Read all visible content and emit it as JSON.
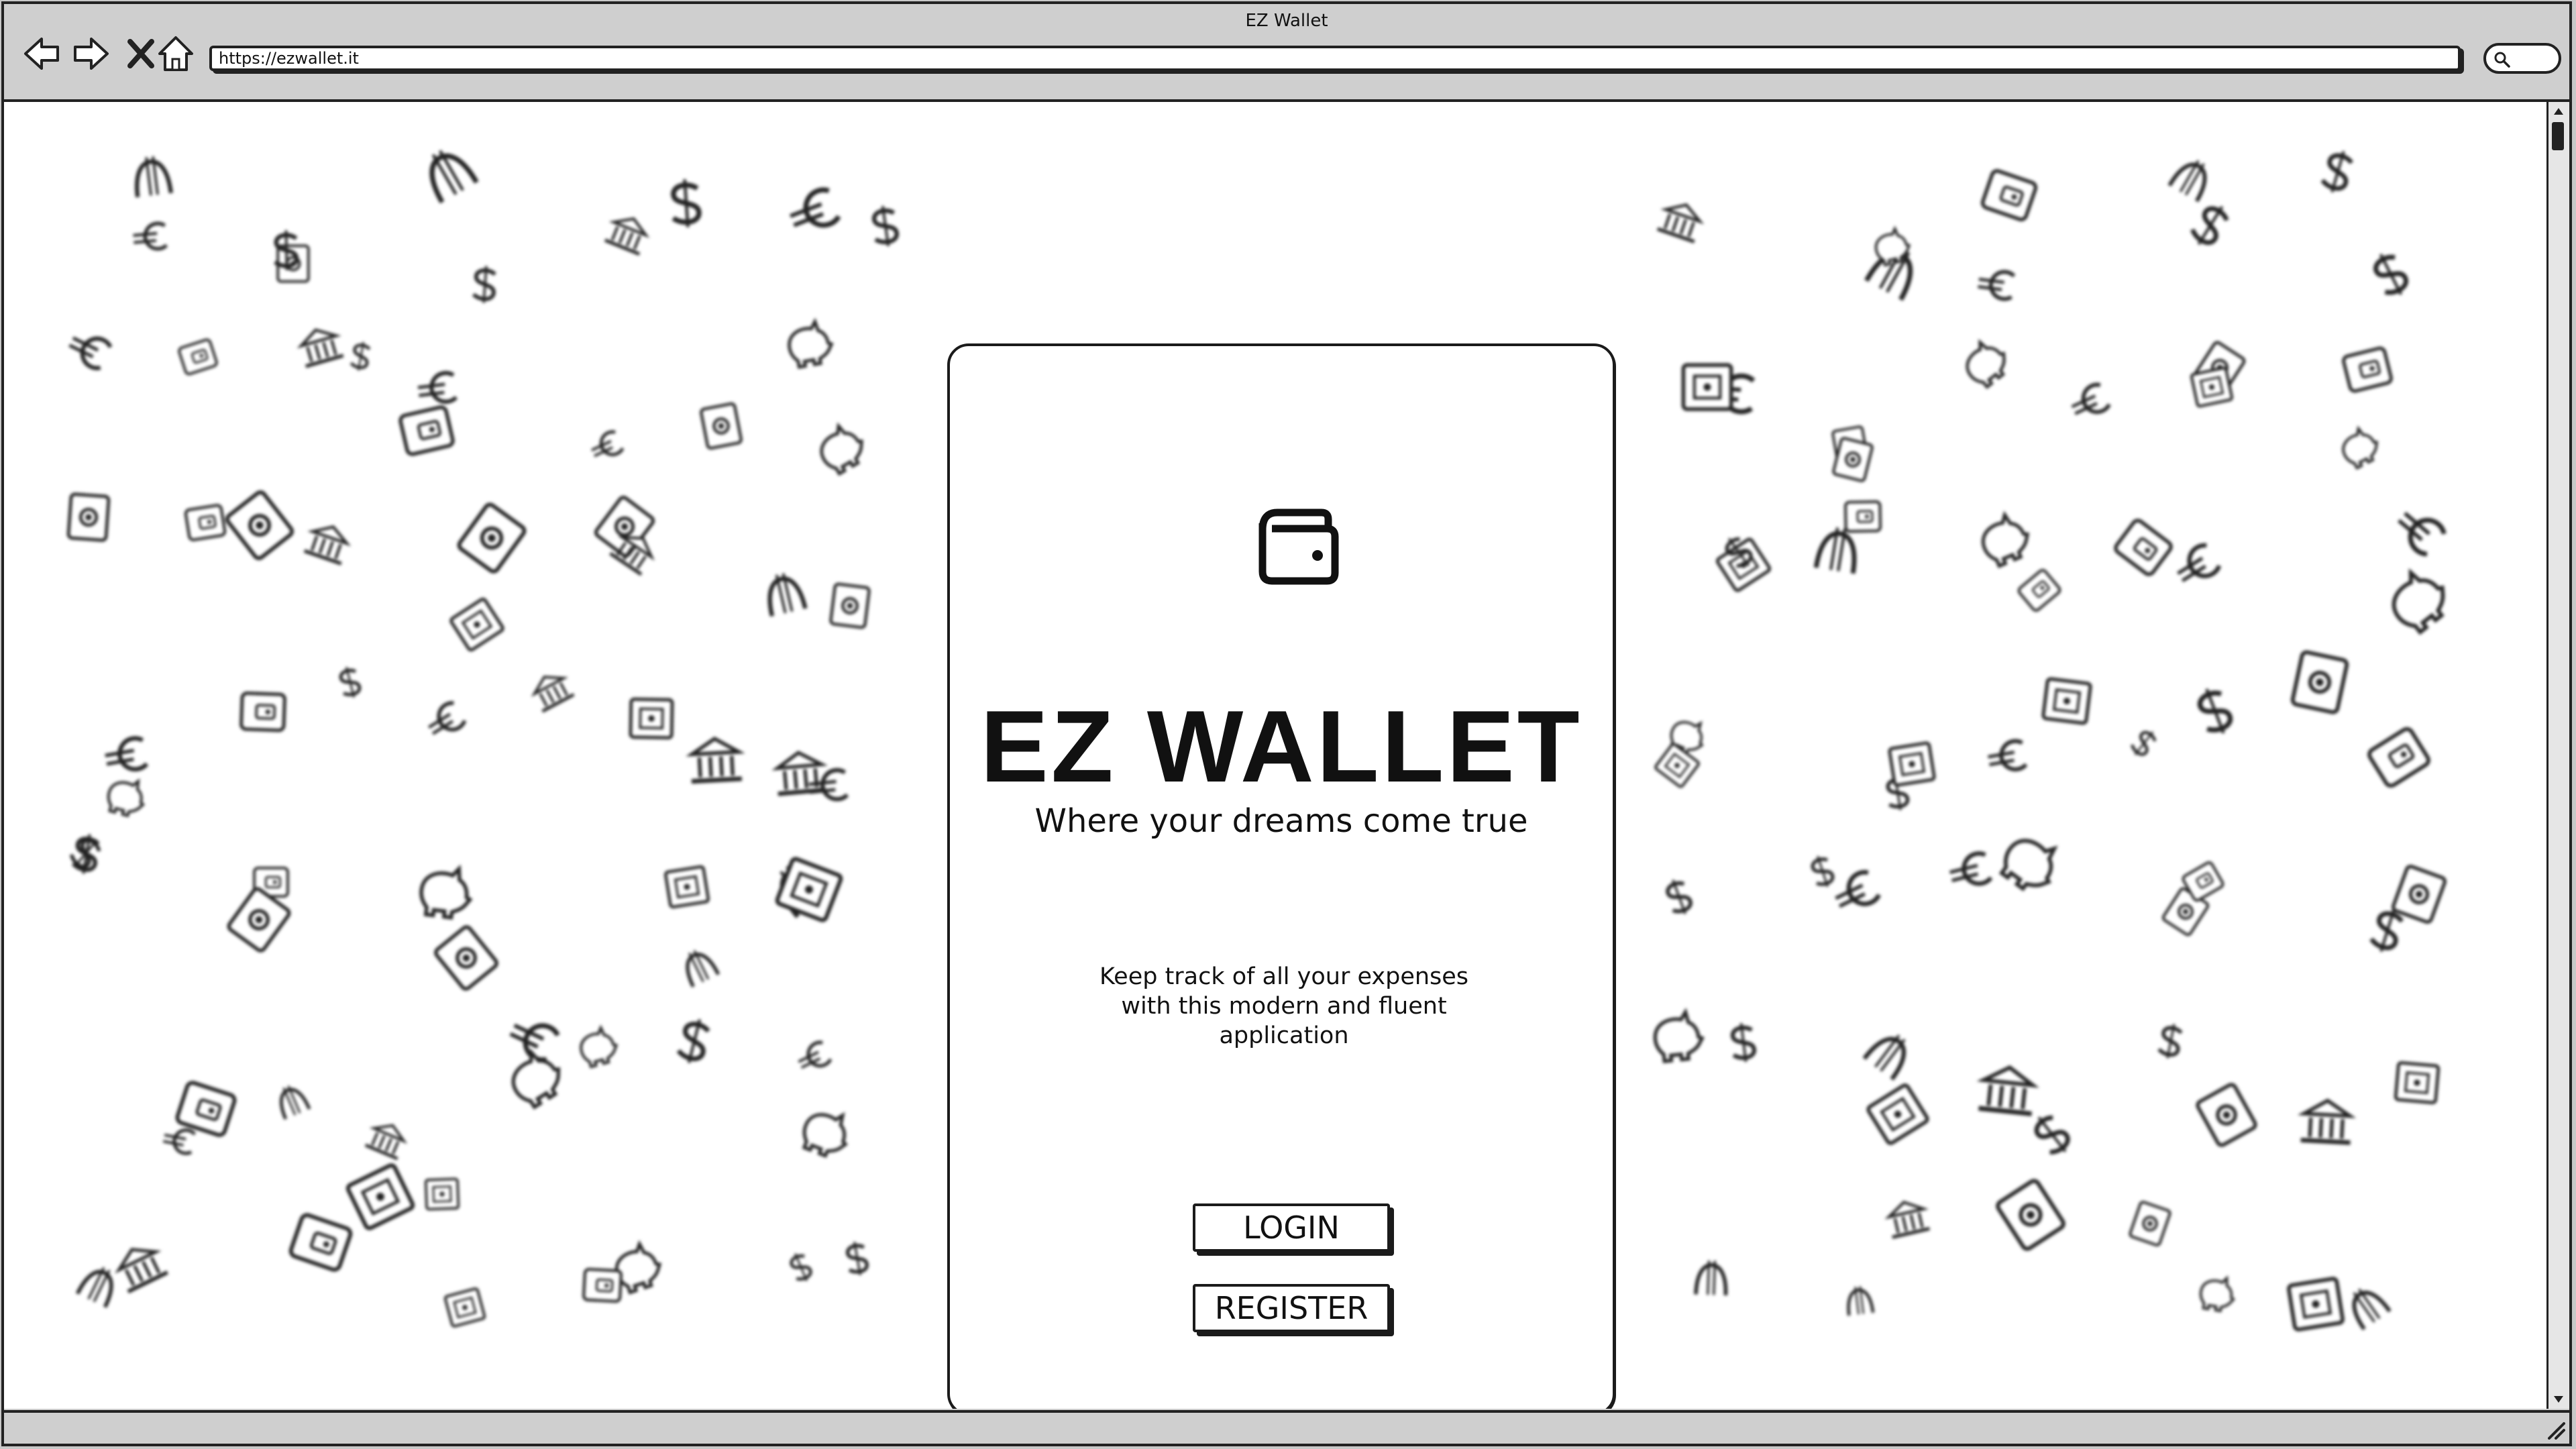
{
  "window": {
    "title": "EZ Wallet"
  },
  "browser": {
    "url": "https://ezwallet.it",
    "icons": [
      "back-icon",
      "forward-icon",
      "close-icon",
      "home-icon",
      "search-icon"
    ]
  },
  "card": {
    "icon": "wallet-icon",
    "title": "EZ WALLET",
    "tagline": "Where your dreams come true",
    "description": "Keep track of all your expenses with this modern and fluent application",
    "login_label": "LOGIN",
    "register_label": "REGISTER"
  },
  "background": {
    "icons": [
      "euro-icon",
      "dollar-icon",
      "bank-icon",
      "wallet-icon",
      "piggy-bank-icon",
      "banknote-icon",
      "safe-icon",
      "baht-icon"
    ]
  }
}
